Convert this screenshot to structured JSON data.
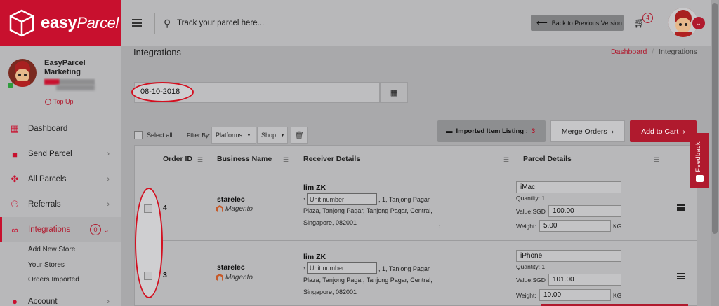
{
  "brand": {
    "name_part1": "easy",
    "name_part2": "Parcel"
  },
  "user": {
    "name": "EasyParcel Marketing",
    "topup_label": "Top Up"
  },
  "sidebar": {
    "items": [
      {
        "label": "Dashboard",
        "icon": "dashboard-icon",
        "has_chevron": false
      },
      {
        "label": "Send Parcel",
        "icon": "truck-icon",
        "has_chevron": true
      },
      {
        "label": "All Parcels",
        "icon": "boxes-icon",
        "has_chevron": true
      },
      {
        "label": "Referrals",
        "icon": "users-icon",
        "has_chevron": true
      },
      {
        "label": "Integrations",
        "icon": "link-icon",
        "badge": "0",
        "active": true
      },
      {
        "label": "Account",
        "icon": "user-icon",
        "has_chevron": true
      }
    ],
    "sub_items": [
      "Add New Store",
      "Your Stores",
      "Orders Imported"
    ]
  },
  "header": {
    "search_placeholder": "Track your parcel here...",
    "back_label": "Back to Previous Version",
    "cart_count": "4"
  },
  "page": {
    "title": "Integrations",
    "breadcrumb_home": "Dashboard",
    "breadcrumb_sep": "/",
    "breadcrumb_current": "Integrations",
    "date_value": "08-10-2018"
  },
  "toolbar": {
    "select_all": "Select all",
    "filter_by": "Filter By:",
    "platforms": "Platforms",
    "shop": "Shop",
    "imported_label": "Imported Item Listing :",
    "imported_count": "3",
    "merge_label": "Merge Orders",
    "add_cart_label": "Add to Cart"
  },
  "table": {
    "headers": [
      "Order ID",
      "Business Name",
      "Receiver Details",
      "Parcel Details"
    ],
    "rows": [
      {
        "order_id": "4",
        "business": "starelec",
        "platform": "Magento",
        "receiver_name": "lim ZK",
        "unit_placeholder": "Unit number",
        "addr_prefix": ",",
        "addr_tail": ", 1, Tanjong Pagar",
        "addr_line2": "Plaza, Tanjong Pagar, Tanjong Pagar, Central,",
        "addr_line3": "Singapore, 082001",
        "item": "iMac",
        "quantity": "Quantity: 1",
        "value_label": "Value:SGD",
        "value": "100.00",
        "weight_label": "Weight:",
        "weight": "5.00",
        "weight_unit": "KG"
      },
      {
        "order_id": "3",
        "business": "starelec",
        "platform": "Magento",
        "receiver_name": "lim ZK",
        "unit_placeholder": "Unit number",
        "addr_prefix": ",",
        "addr_tail": ", 1, Tanjong Pagar",
        "addr_line2": "Plaza, Tanjong Pagar, Tanjong Pagar, Central,",
        "addr_line3": "Singapore, 082001",
        "item": "iPhone",
        "quantity": "Quantity: 1",
        "value_label": "Value:SGD",
        "value": "101.00",
        "weight_label": "Weight:",
        "weight": "10.00",
        "weight_unit": "KG"
      }
    ]
  },
  "feedback_label": "Feedback",
  "colors": {
    "brand_red": "#c8102e",
    "annotation_red": "#d31020"
  }
}
